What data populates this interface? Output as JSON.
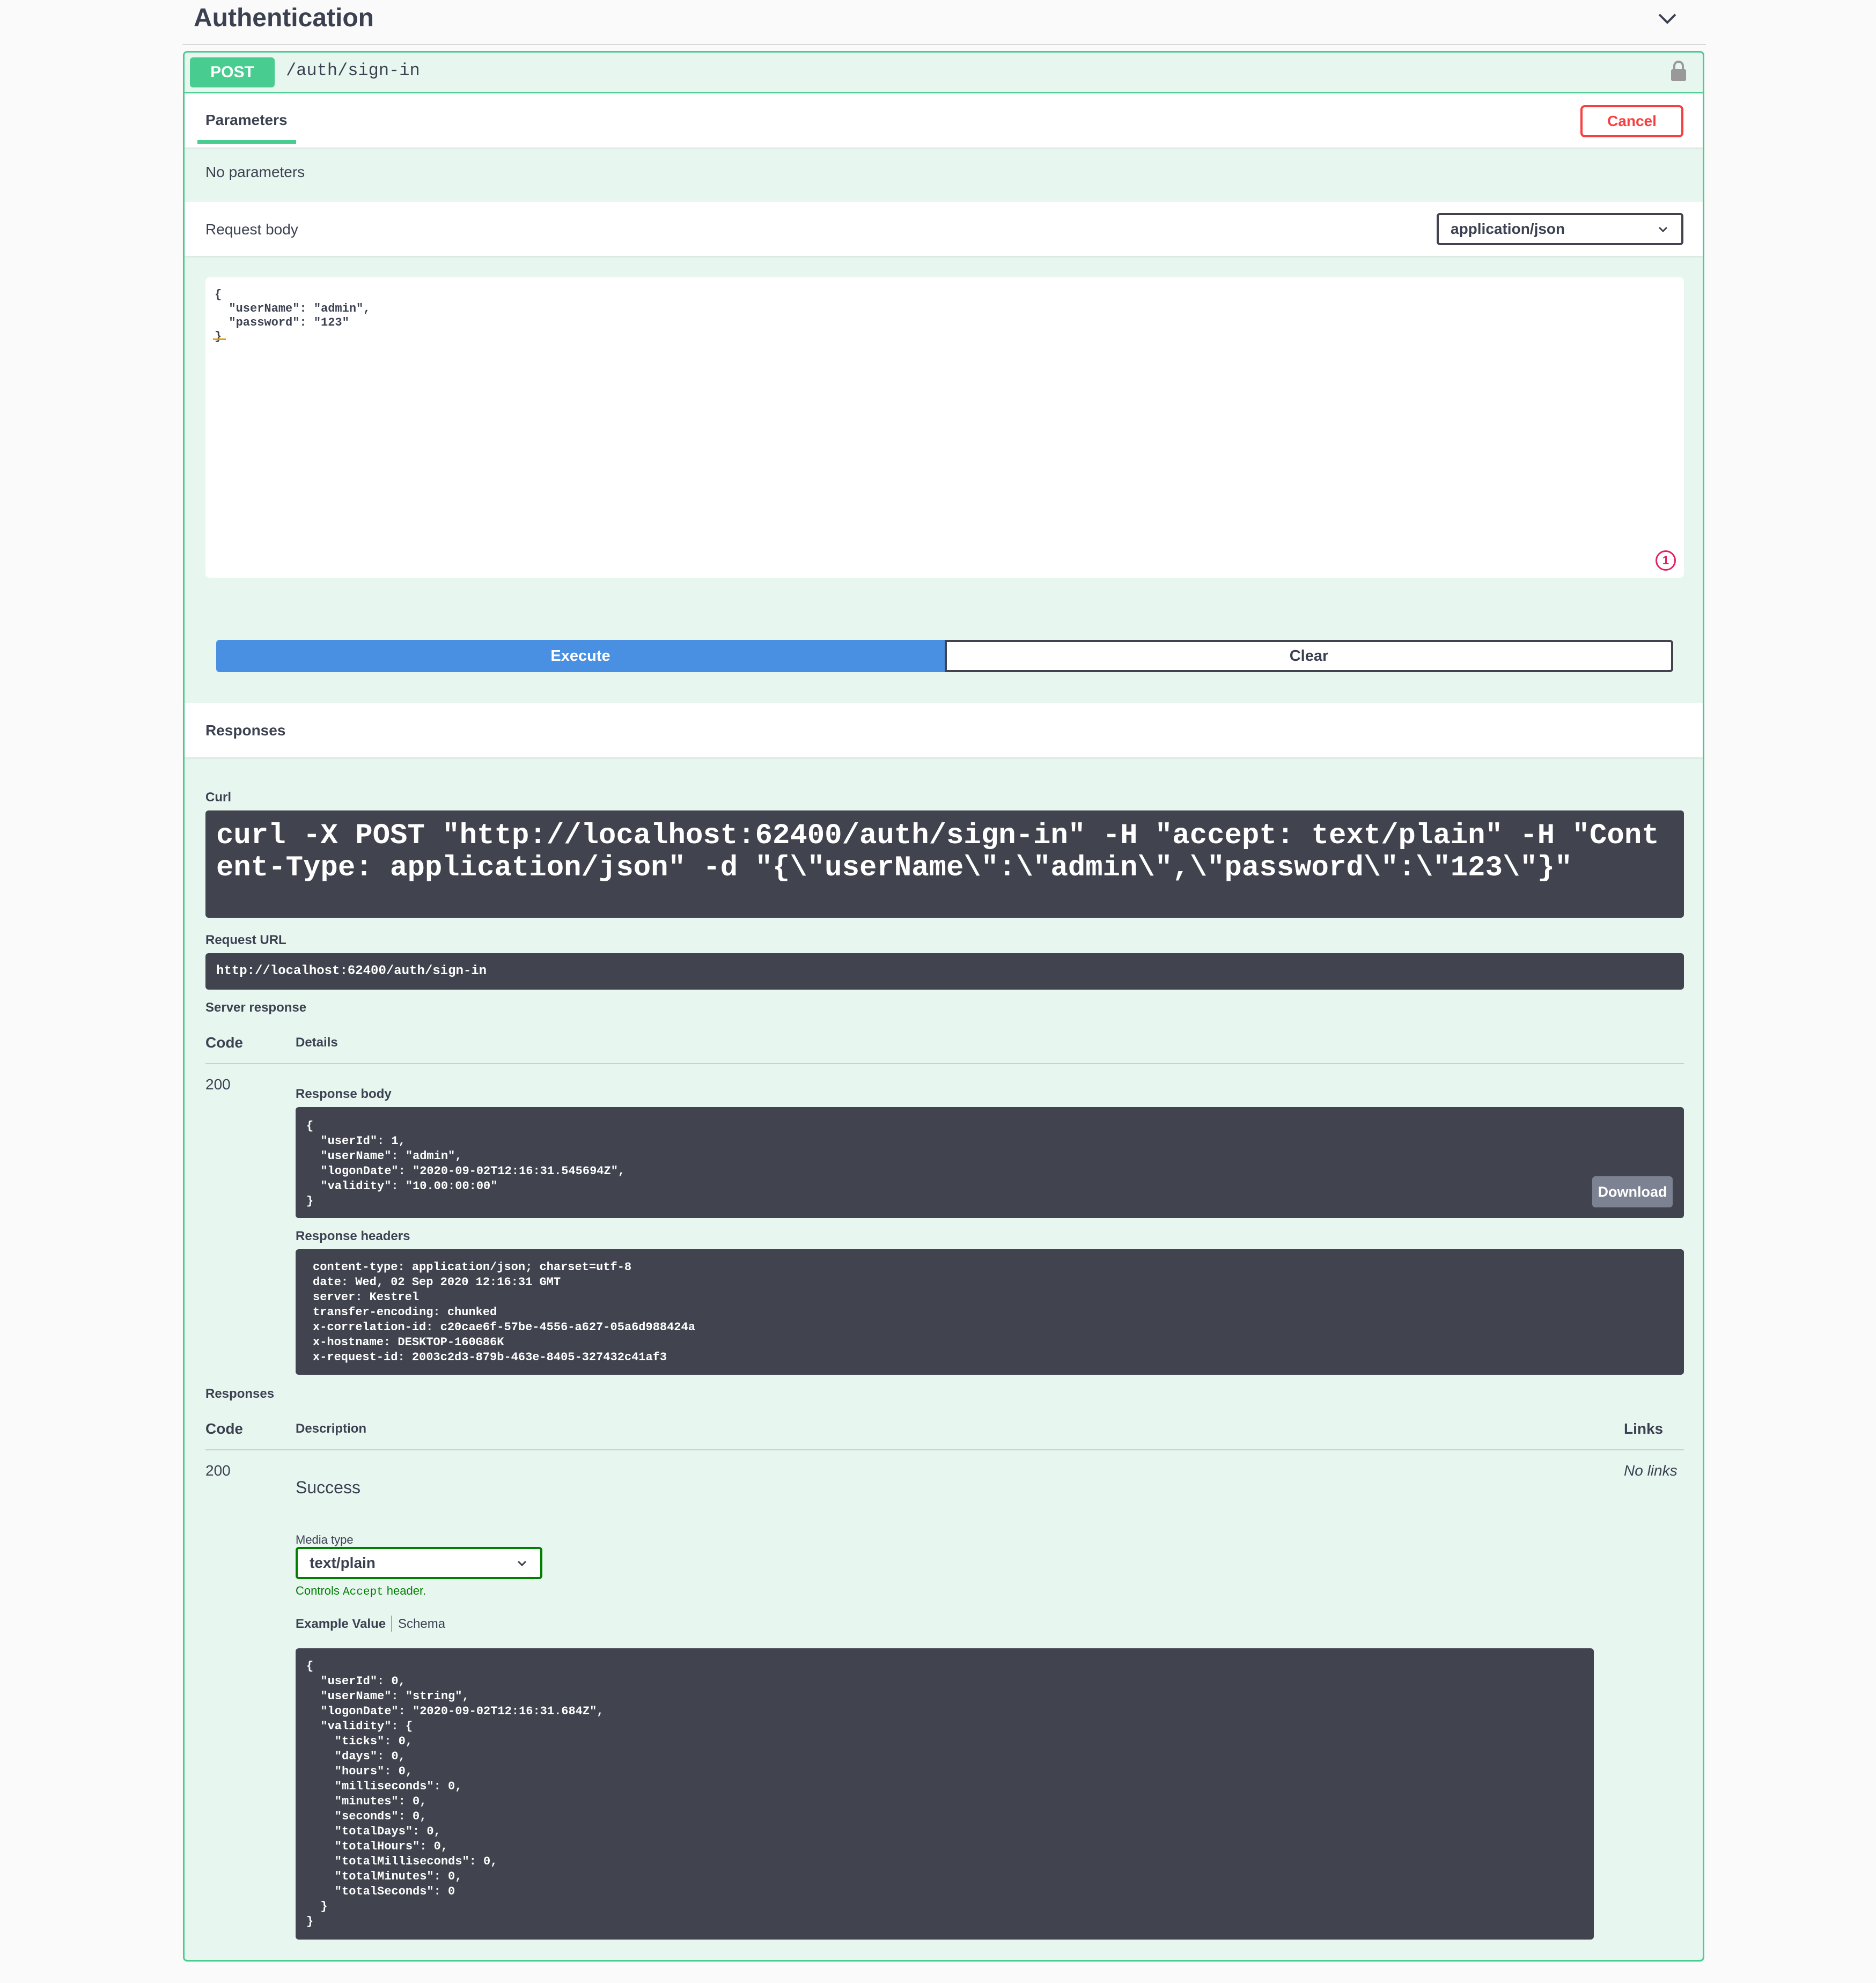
{
  "section": {
    "title": "Authentication"
  },
  "operation": {
    "method": "POST",
    "path": "/auth/sign-in"
  },
  "params": {
    "tab_label": "Parameters",
    "cancel_label": "Cancel",
    "empty_text": "No parameters"
  },
  "request_body": {
    "label": "Request body",
    "content_type": "application/json",
    "editor_value": "{\n  \"userName\": \"admin\",\n  \"password\": \"123\"\n}",
    "error_count": "1"
  },
  "actions": {
    "execute_label": "Execute",
    "clear_label": "Clear"
  },
  "responses_header": "Responses",
  "live": {
    "curl_label": "Curl",
    "curl_command": "curl -X POST \"http://localhost:62400/auth/sign-in\" -H \"accept: text/plain\" -H \"Content-Type: application/json\" -d \"{\\\"userName\\\":\\\"admin\\\",\\\"password\\\":\\\"123\\\"}\"",
    "request_url_label": "Request URL",
    "request_url": "http://localhost:62400/auth/sign-in",
    "server_response_label": "Server response",
    "col_code": "Code",
    "col_details": "Details",
    "status_code": "200",
    "response_body_label": "Response body",
    "response_body": "{\n  \"userId\": 1,\n  \"userName\": \"admin\",\n  \"logonDate\": \"2020-09-02T12:16:31.545694Z\",\n  \"validity\": \"10.00:00:00\"\n}",
    "download_label": "Download",
    "response_headers_label": "Response headers",
    "response_headers": "content-type: application/json; charset=utf-8\ndate: Wed, 02 Sep 2020 12:16:31 GMT\nserver: Kestrel\ntransfer-encoding: chunked\nx-correlation-id: c20cae6f-57be-4556-a627-05a6d988424a\nx-hostname: DESKTOP-160G86K\nx-request-id: 2003c2d3-879b-463e-8405-327432c41af3"
  },
  "documented": {
    "label": "Responses",
    "col_code": "Code",
    "col_description": "Description",
    "col_links": "Links",
    "code": "200",
    "description": "Success",
    "links": "No links",
    "media_type_label": "Media type",
    "media_type_value": "text/plain",
    "controls_prefix": "Controls ",
    "controls_code": "Accept",
    "controls_suffix": " header.",
    "example_tab": "Example Value",
    "schema_tab": "Schema",
    "example_value": "{\n  \"userId\": 0,\n  \"userName\": \"string\",\n  \"logonDate\": \"2020-09-02T12:16:31.684Z\",\n  \"validity\": {\n    \"ticks\": 0,\n    \"days\": 0,\n    \"hours\": 0,\n    \"milliseconds\": 0,\n    \"minutes\": 0,\n    \"seconds\": 0,\n    \"totalDays\": 0,\n    \"totalHours\": 0,\n    \"totalMilliseconds\": 0,\n    \"totalMinutes\": 0,\n    \"totalSeconds\": 0\n  }\n}"
  },
  "colors": {
    "post_green": "#49cc90",
    "opblock_bg": "#e8f6f0",
    "execute_blue": "#4990e2",
    "cancel_red": "#f93e3e",
    "code_bg": "#41444e",
    "text": "#3b4151",
    "media_green": "#008000"
  },
  "icons": {
    "section_toggle": "chevron-down-icon",
    "auth": "lock-icon",
    "select_arrow": "chevron-down-icon",
    "validation": "error-badge-icon"
  }
}
